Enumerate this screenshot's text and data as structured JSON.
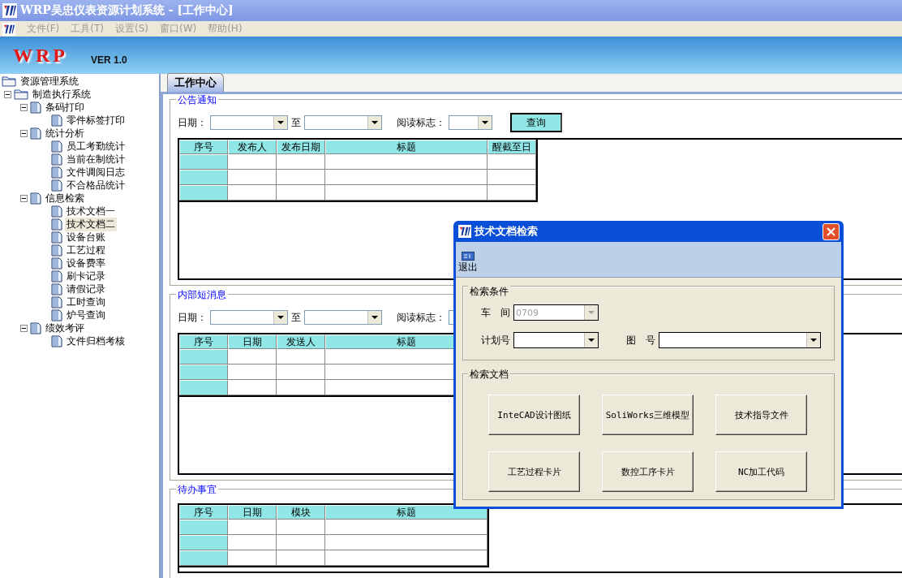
{
  "window": {
    "title": "WRP吴忠仪表资源计划系统 - [工作中心]"
  },
  "menu": [
    {
      "label": "文件(F)",
      "disabled": true
    },
    {
      "label": "工具(T)",
      "disabled": true
    },
    {
      "label": "设置(S)",
      "disabled": true
    },
    {
      "label": "窗口(W)",
      "disabled": true
    },
    {
      "label": "帮助(H)",
      "disabled": true
    }
  ],
  "banner": {
    "logo": "WRP",
    "version": "VER 1.0"
  },
  "tree": [
    {
      "label": "资源管理系统",
      "kind": "folder",
      "selected": false,
      "children": [
        {
          "label": "制造执行系统",
          "kind": "folder",
          "expanded": true,
          "selected": false,
          "children": [
            {
              "label": "条码打印",
              "kind": "page",
              "expanded": true,
              "selected": false,
              "children": [
                {
                  "label": "零件标签打印",
                  "kind": "page",
                  "selected": false
                }
              ]
            },
            {
              "label": "统计分析",
              "kind": "page",
              "expanded": true,
              "selected": false,
              "children": [
                {
                  "label": "员工考勤统计",
                  "kind": "page",
                  "selected": false
                },
                {
                  "label": "当前在制统计",
                  "kind": "page",
                  "selected": false
                },
                {
                  "label": "文件调阅日志",
                  "kind": "page",
                  "selected": false
                },
                {
                  "label": "不合格品统计",
                  "kind": "page",
                  "selected": false
                }
              ]
            },
            {
              "label": "信息检索",
              "kind": "page",
              "expanded": true,
              "selected": false,
              "children": [
                {
                  "label": "技术文档一",
                  "kind": "page",
                  "selected": false
                },
                {
                  "label": "技术文档二",
                  "kind": "page",
                  "selected": true
                },
                {
                  "label": "设备台账",
                  "kind": "page",
                  "selected": false
                },
                {
                  "label": "工艺过程",
                  "kind": "page",
                  "selected": false
                },
                {
                  "label": "设备费率",
                  "kind": "page",
                  "selected": false
                },
                {
                  "label": "刷卡记录",
                  "kind": "page",
                  "selected": false
                },
                {
                  "label": "请假记录",
                  "kind": "page",
                  "selected": false
                },
                {
                  "label": "工时查询",
                  "kind": "page",
                  "selected": false
                },
                {
                  "label": "炉号查询",
                  "kind": "page",
                  "selected": false
                }
              ]
            },
            {
              "label": "绩效考评",
              "kind": "page",
              "expanded": true,
              "selected": false,
              "children": [
                {
                  "label": "文件归档考核",
                  "kind": "page",
                  "selected": false
                }
              ]
            }
          ]
        }
      ]
    }
  ],
  "tabs": [
    {
      "label": "工作中心",
      "selected": true
    }
  ],
  "sections": [
    {
      "legend": "公告通知",
      "filters": {
        "date_label": "日期：",
        "to_label": "至",
        "read_label": "阅读标志：",
        "button": "查询"
      },
      "table": {
        "columns": [
          "序号",
          "发布人",
          "发布日期",
          "标题",
          "醒截至日"
        ]
      }
    },
    {
      "legend": "内部短消息",
      "filters": {
        "date_label": "日期：",
        "to_label": "至",
        "read_label": "阅读标志："
      },
      "table": {
        "columns": [
          "序号",
          "日期",
          "发送人",
          "标题"
        ]
      }
    },
    {
      "legend": "待办事宜",
      "table": {
        "columns": [
          "序号",
          "日期",
          "模块",
          "标题"
        ]
      }
    }
  ],
  "dialog": {
    "title": "技术文档检索",
    "toolbar": [
      {
        "label": "退出"
      }
    ],
    "criteria": {
      "legend": "检索条件",
      "fields": [
        {
          "label": "车　间",
          "value": "0709",
          "disabled": true
        },
        {
          "label": "计划号",
          "disabled": false
        },
        {
          "label": "图　号",
          "disabled": false
        }
      ]
    },
    "documents": {
      "legend": "检索文档",
      "buttons": [
        "InteCAD设计图纸",
        "SoliWorks三维模型",
        "技术指导文件",
        "工艺过程卡片",
        "数控工序卡片",
        "NC加工代码"
      ]
    }
  }
}
